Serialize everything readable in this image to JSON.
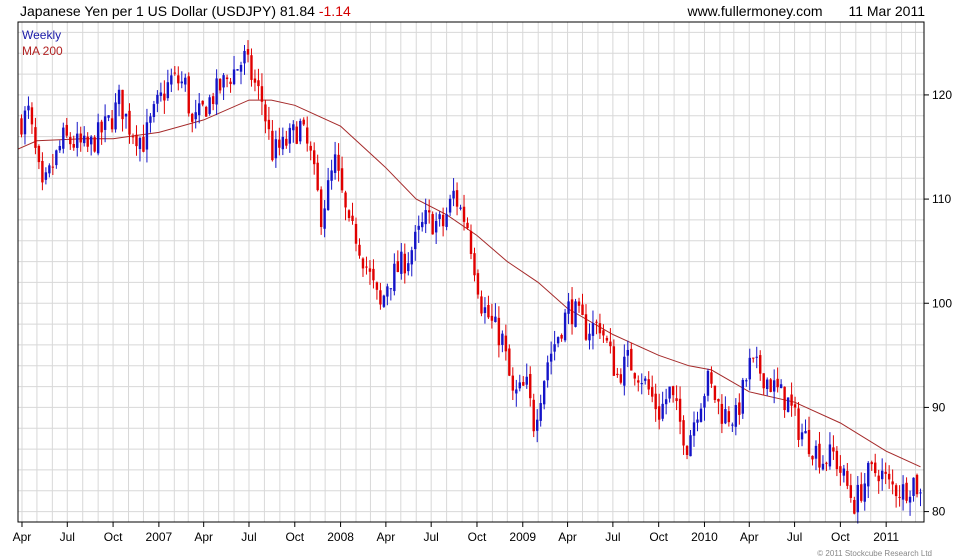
{
  "header": {
    "name": "Japanese Yen per 1 US Dollar (USDJPY)",
    "last": "81.84",
    "change": "-1.14",
    "site": "www.fullermoney.com",
    "date": "11 Mar 2011"
  },
  "legend": {
    "weekly": "Weekly",
    "ma": "MA 200"
  },
  "copyright": "© 2011 Stockcube Research Ltd",
  "colors": {
    "up": "#1414c8",
    "down": "#e00000",
    "ma": "#a52a2a",
    "grid": "#d8d8d8",
    "axis": "#000000"
  },
  "chart_data": {
    "type": "candlestick",
    "ylim": [
      79,
      127
    ],
    "yticks": [
      80,
      90,
      100,
      110,
      120
    ],
    "ytick_labels": [
      "80",
      "90",
      "100",
      "110",
      "120"
    ],
    "x_start": "2006-03-24",
    "x_end": "2011-03-18",
    "xticks": [
      {
        "date": "2006-04-01",
        "label": "Apr"
      },
      {
        "date": "2006-07-01",
        "label": "Jul"
      },
      {
        "date": "2006-10-01",
        "label": "Oct"
      },
      {
        "date": "2007-01-01",
        "label": "2007"
      },
      {
        "date": "2007-04-01",
        "label": "Apr"
      },
      {
        "date": "2007-07-01",
        "label": "Jul"
      },
      {
        "date": "2007-10-01",
        "label": "Oct"
      },
      {
        "date": "2008-01-01",
        "label": "2008"
      },
      {
        "date": "2008-04-01",
        "label": "Apr"
      },
      {
        "date": "2008-07-01",
        "label": "Jul"
      },
      {
        "date": "2008-10-01",
        "label": "Oct"
      },
      {
        "date": "2009-01-01",
        "label": "2009"
      },
      {
        "date": "2009-04-01",
        "label": "Apr"
      },
      {
        "date": "2009-07-01",
        "label": "Jul"
      },
      {
        "date": "2009-10-01",
        "label": "Oct"
      },
      {
        "date": "2010-01-01",
        "label": "2010"
      },
      {
        "date": "2010-04-01",
        "label": "Apr"
      },
      {
        "date": "2010-07-01",
        "label": "Jul"
      },
      {
        "date": "2010-10-01",
        "label": "Oct"
      },
      {
        "date": "2011-01-01",
        "label": "2011"
      }
    ],
    "price_anchors": [
      [
        "2006-03-31",
        117.5
      ],
      [
        "2006-04-14",
        118.3
      ],
      [
        "2006-05-12",
        110.5
      ],
      [
        "2006-05-19",
        111.5
      ],
      [
        "2006-06-23",
        115.8
      ],
      [
        "2006-08-11",
        114.8
      ],
      [
        "2006-09-29",
        117.8
      ],
      [
        "2006-10-13",
        119.5
      ],
      [
        "2006-11-03",
        117.0
      ],
      [
        "2006-12-01",
        115.5
      ],
      [
        "2006-12-29",
        119.0
      ],
      [
        "2007-01-26",
        121.5
      ],
      [
        "2007-02-23",
        121.0
      ],
      [
        "2007-03-09",
        117.0
      ],
      [
        "2007-04-13",
        119.5
      ],
      [
        "2007-06-22",
        123.5
      ],
      [
        "2007-07-13",
        121.0
      ],
      [
        "2007-07-27",
        119.5
      ],
      [
        "2007-08-17",
        114.5
      ],
      [
        "2007-09-07",
        115.0
      ],
      [
        "2007-10-12",
        117.0
      ],
      [
        "2007-11-02",
        114.0
      ],
      [
        "2007-11-23",
        108.5
      ],
      [
        "2007-12-21",
        113.5
      ],
      [
        "2008-01-18",
        107.0
      ],
      [
        "2008-02-01",
        106.5
      ],
      [
        "2008-03-21",
        99.5
      ],
      [
        "2008-04-04",
        102.0
      ],
      [
        "2008-05-16",
        104.5
      ],
      [
        "2008-06-20",
        108.0
      ],
      [
        "2008-07-25",
        107.5
      ],
      [
        "2008-08-15",
        110.5
      ],
      [
        "2008-09-12",
        107.5
      ],
      [
        "2008-10-10",
        100.0
      ],
      [
        "2008-10-31",
        98.0
      ],
      [
        "2008-11-21",
        96.5
      ],
      [
        "2008-12-12",
        91.0
      ],
      [
        "2009-01-09",
        92.0
      ],
      [
        "2009-01-23",
        88.5
      ],
      [
        "2009-02-20",
        94.5
      ],
      [
        "2009-04-03",
        99.5
      ],
      [
        "2009-04-17",
        99.0
      ],
      [
        "2009-05-08",
        97.5
      ],
      [
        "2009-06-05",
        98.0
      ],
      [
        "2009-07-10",
        93.0
      ],
      [
        "2009-07-31",
        94.5
      ],
      [
        "2009-08-28",
        93.0
      ],
      [
        "2009-10-02",
        89.5
      ],
      [
        "2009-10-23",
        91.5
      ],
      [
        "2009-11-27",
        86.5
      ],
      [
        "2009-12-18",
        90.0
      ],
      [
        "2010-01-08",
        92.5
      ],
      [
        "2010-02-05",
        89.5
      ],
      [
        "2010-03-05",
        89.0
      ],
      [
        "2010-04-02",
        94.0
      ],
      [
        "2010-04-23",
        93.5
      ],
      [
        "2010-05-28",
        91.5
      ],
      [
        "2010-06-18",
        90.5
      ],
      [
        "2010-07-09",
        88.0
      ],
      [
        "2010-08-27",
        85.0
      ],
      [
        "2010-09-17",
        85.5
      ],
      [
        "2010-10-29",
        80.8
      ],
      [
        "2010-11-26",
        83.5
      ],
      [
        "2010-12-17",
        84.0
      ],
      [
        "2011-01-07",
        82.5
      ],
      [
        "2011-02-04",
        82.0
      ],
      [
        "2011-02-25",
        83.0
      ],
      [
        "2011-03-11",
        81.84
      ]
    ],
    "ma200": [
      [
        "2006-03-24",
        114.8
      ],
      [
        "2006-05-01",
        115.6
      ],
      [
        "2006-08-01",
        115.8
      ],
      [
        "2006-10-01",
        115.8
      ],
      [
        "2007-01-01",
        116.4
      ],
      [
        "2007-04-01",
        117.6
      ],
      [
        "2007-07-01",
        119.5
      ],
      [
        "2007-08-15",
        119.5
      ],
      [
        "2007-10-01",
        119.0
      ],
      [
        "2008-01-01",
        117.0
      ],
      [
        "2008-04-01",
        113.0
      ],
      [
        "2008-06-01",
        110.0
      ],
      [
        "2008-08-01",
        108.5
      ],
      [
        "2008-10-01",
        106.5
      ],
      [
        "2008-12-01",
        104.0
      ],
      [
        "2009-02-01",
        102.0
      ],
      [
        "2009-04-01",
        99.5
      ],
      [
        "2009-07-01",
        97.0
      ],
      [
        "2009-10-01",
        95.0
      ],
      [
        "2009-12-01",
        94.0
      ],
      [
        "2010-01-15",
        93.6
      ],
      [
        "2010-04-01",
        91.5
      ],
      [
        "2010-07-01",
        90.5
      ],
      [
        "2010-10-01",
        88.5
      ],
      [
        "2011-01-01",
        85.8
      ],
      [
        "2011-03-11",
        84.3
      ]
    ]
  }
}
